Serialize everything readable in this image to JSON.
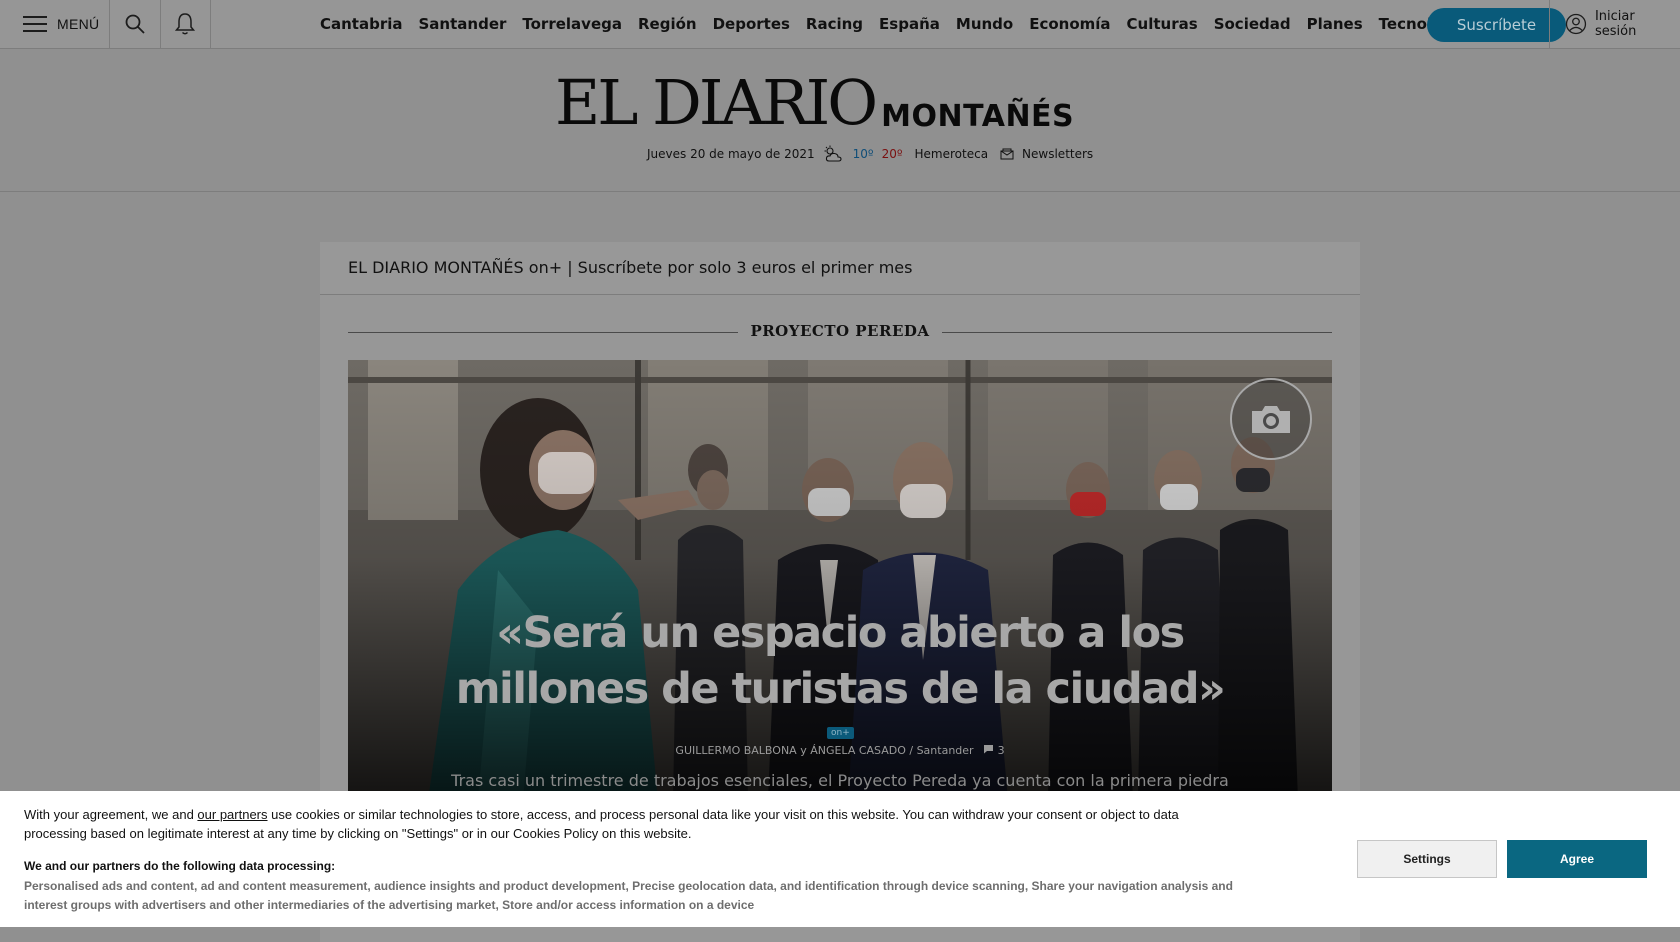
{
  "nav": {
    "menu_label": "MENÚ",
    "sections": [
      "Cantabria",
      "Santander",
      "Torrelavega",
      "Región",
      "Deportes",
      "Racing",
      "España",
      "Mundo",
      "Economía",
      "Culturas",
      "Sociedad",
      "Planes",
      "Tecnología"
    ],
    "subscribe_label": "Suscríbete",
    "login_label": "Iniciar sesión"
  },
  "masthead": {
    "logo_main": "EL DIARIO",
    "logo_sub": "MONTAÑÉS",
    "date": "Jueves 20 de mayo de 2021",
    "temp_min": "10º",
    "temp_max": "20º",
    "archive_label": "Hemeroteca",
    "newsletters_label": "Newsletters"
  },
  "promo": {
    "text": "EL DIARIO MONTAÑÉS on+ | Suscríbete por solo 3 euros el primer mes"
  },
  "article": {
    "kicker": "PROYECTO PEREDA",
    "headline_line1": "«Será un espacio abierto a los",
    "headline_line2": "millones de turistas de la ciudad»",
    "badge": "on+",
    "byline": "GUILLERMO BALBONA y ÁNGELA CASADO / Santander",
    "comments": "3",
    "lede": "Tras casi un trimestre de trabajos esenciales, el Proyecto Pereda ya cuenta con la primera piedra para simbolizar la"
  },
  "cookie": {
    "text_before_link": "With your agreement, we and ",
    "link_text": "our partners",
    "text_after_link": " use cookies or similar technologies to store, access, and process personal data like your visit on this website. You can withdraw your consent or object to data processing based on legitimate interest at any time by clicking on \"Settings\" or in our Cookies Policy on this website.",
    "purposes_title": "We and our partners do the following data processing:",
    "purposes": "Personalised ads and content, ad and content measurement, audience insights and product development, Precise geolocation data, and identification through device scanning, Share your navigation analysis and interest groups with advertisers and other intermediaries of the advertising market, Store and/or access information on a device",
    "settings_label": "Settings",
    "agree_label": "Agree"
  },
  "icons": [
    "menu-icon",
    "search-icon",
    "bell-icon",
    "user-icon",
    "weather-icon",
    "newsletter-icon",
    "camera-icon",
    "comment-icon"
  ],
  "colors": {
    "subscribe": "#095a7a",
    "agree": "#0a6781",
    "temp_min": "#0e4d78",
    "temp_max": "#7a1010"
  }
}
